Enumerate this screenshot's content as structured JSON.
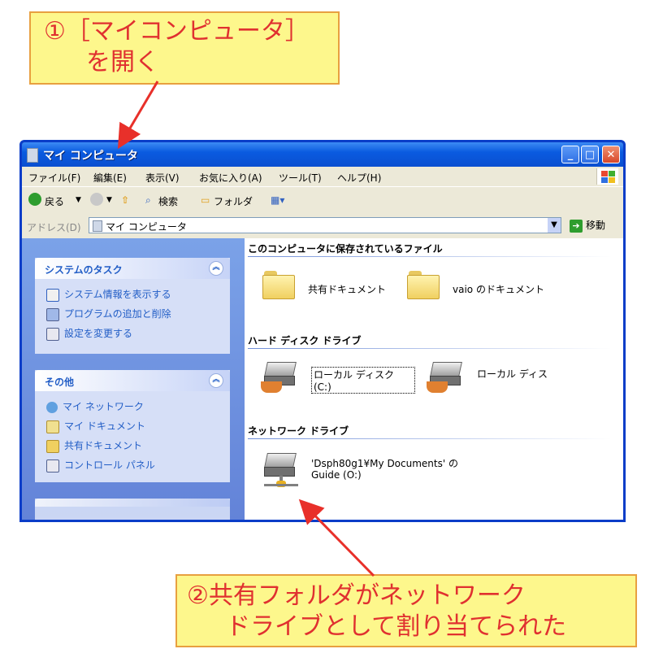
{
  "callouts": {
    "step1_line1": "①［マイコンピュータ］",
    "step1_line2": "を開く",
    "step2_line1": "②共有フォルダがネットワーク",
    "step2_line2": "ドライブとして割り当てられた"
  },
  "window": {
    "title": "マイ コンピュータ",
    "menu": [
      "ファイル(F)",
      "編集(E)",
      "表示(V)",
      "お気に入り(A)",
      "ツール(T)",
      "ヘルプ(H)"
    ],
    "toolbar": {
      "back": "戻る",
      "search": "検索",
      "folders": "フォルダ"
    },
    "address": {
      "label": "アドレス(D)",
      "value": "マイ コンピュータ",
      "go": "移動"
    }
  },
  "taskpane": {
    "system_tasks": {
      "title": "システムのタスク",
      "items": [
        "システム情報を表示する",
        "プログラムの追加と削除",
        "設定を変更する"
      ]
    },
    "other_places": {
      "title": "その他",
      "items": [
        "マイ ネットワーク",
        "マイ ドキュメント",
        "共有ドキュメント",
        "コントロール パネル"
      ]
    }
  },
  "content": {
    "stored_files": {
      "header": "このコンピュータに保存されているファイル",
      "items": [
        "共有ドキュメント",
        "vaio のドキュメント"
      ]
    },
    "hard_disks": {
      "header": "ハード ディスク ドライブ",
      "items": [
        "ローカル ディスク (C:)",
        "ローカル ディス"
      ]
    },
    "network_drives": {
      "header": "ネットワーク ドライブ",
      "item_line1": "'Dsph80g1¥My Documents' の",
      "item_line2": "Guide (O:)"
    }
  },
  "colors": {
    "callout_bg": "#fdf78c",
    "callout_text": "#e03030",
    "titlebar": "#0a5be0",
    "link": "#215dc6",
    "arrow": "#e8302a"
  }
}
